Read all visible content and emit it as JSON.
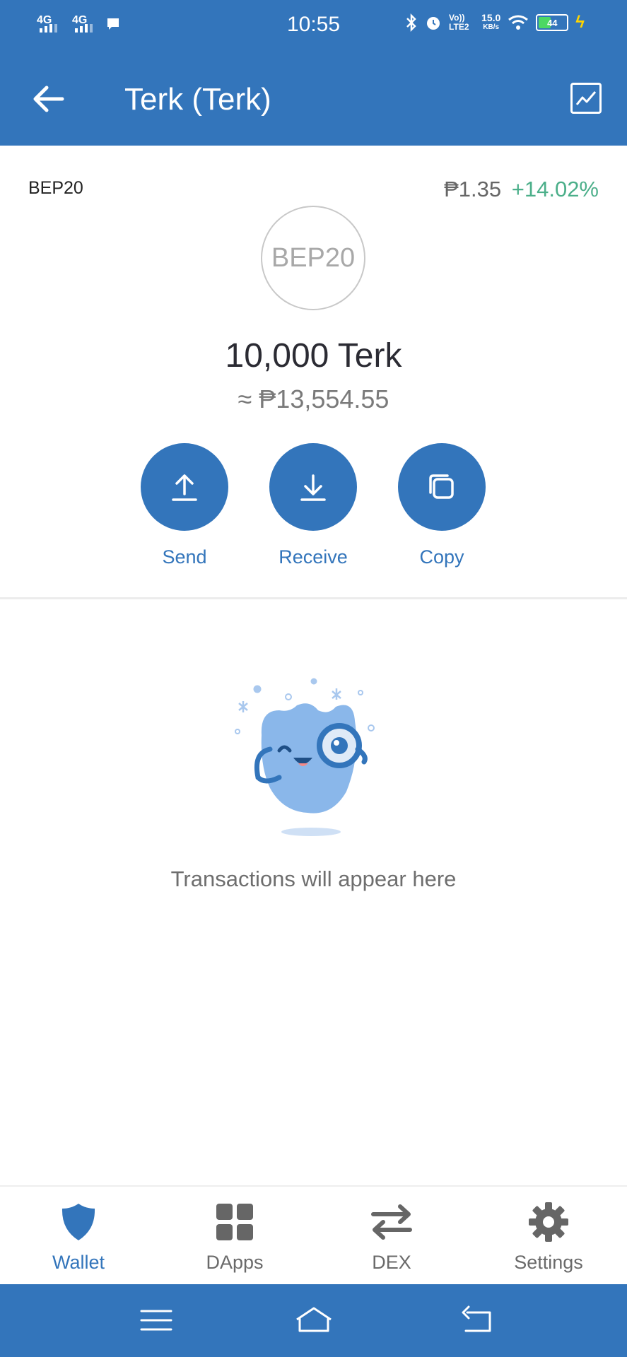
{
  "status_bar": {
    "sim1": "4G",
    "sim2": "4G",
    "time": "10:55",
    "volte": "Vo)) LTE2",
    "net_speed": "15.0",
    "net_unit": "KB/s",
    "battery": "44"
  },
  "header": {
    "title": "Terk (Terk)",
    "back_icon": "arrow-left-icon",
    "chart_icon": "line-chart-icon"
  },
  "token": {
    "network": "BEP20",
    "logo_text": "BEP20",
    "price": "₱1.35",
    "change": "+14.02%",
    "balance": "10,000 Terk",
    "fiat_value": "≈ ₱13,554.55"
  },
  "actions": {
    "send": "Send",
    "receive": "Receive",
    "copy": "Copy"
  },
  "empty_state": {
    "text": "Transactions will appear here"
  },
  "tabs": {
    "wallet": "Wallet",
    "dapps": "DApps",
    "dex": "DEX",
    "settings": "Settings"
  },
  "colors": {
    "primary": "#3375bb",
    "positive": "#4caf8a"
  }
}
